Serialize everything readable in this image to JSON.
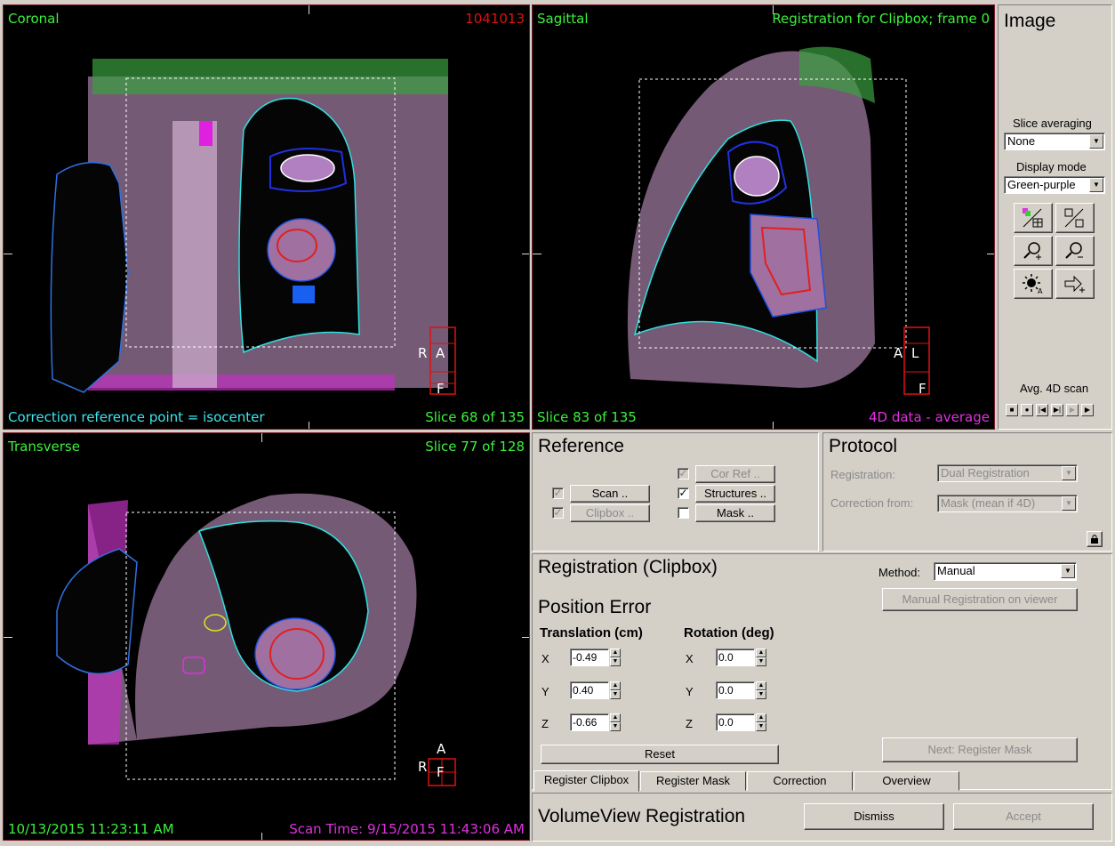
{
  "viewers": {
    "coronal": {
      "title": "Coronal",
      "id_number": "1041013",
      "footer_left": "Correction reference point = isocenter",
      "footer_right": "Slice 68 of 135",
      "orient_left": "R",
      "orient_top": "A",
      "orient_bottom": "F"
    },
    "sagittal": {
      "title": "Sagittal",
      "header_right": "Registration for Clipbox; frame 0",
      "footer_left": "Slice 83 of 135",
      "footer_right": "4D data - average",
      "orient_left": "A",
      "orient_top": "L",
      "orient_bottom": "F"
    },
    "transverse": {
      "title": "Transverse",
      "header_right": "Slice 77 of 128",
      "footer_left": "10/13/2015 11:23:11 AM",
      "footer_right": "Scan Time: 9/15/2015 11:43:06 AM",
      "orient_left": "R",
      "orient_top": "A",
      "orient_center": "F"
    }
  },
  "image_panel": {
    "title": "Image",
    "slice_averaging_label": "Slice averaging",
    "slice_averaging_value": "None",
    "display_mode_label": "Display mode",
    "display_mode_value": "Green-purple",
    "avg_4d_label": "Avg. 4D scan"
  },
  "reference": {
    "title": "Reference",
    "scan": {
      "label": "Scan ..",
      "checked": true,
      "enabled": false
    },
    "clipbox": {
      "label": "Clipbox ..",
      "checked": true,
      "enabled": false
    },
    "cor_ref": {
      "label": "Cor Ref ..",
      "checked": true,
      "enabled": false
    },
    "structures": {
      "label": "Structures ..",
      "checked": true,
      "enabled": true
    },
    "mask": {
      "label": "Mask ..",
      "checked": false,
      "enabled": true
    }
  },
  "protocol": {
    "title": "Protocol",
    "registration_label": "Registration:",
    "registration_value": "Dual Registration",
    "correction_from_label": "Correction from:",
    "correction_from_value": "Mask (mean if 4D)"
  },
  "registration": {
    "title": "Registration (Clipbox)",
    "method_label": "Method:",
    "method_value": "Manual",
    "manual_btn": "Manual Registration on viewer",
    "position_error_title": "Position Error",
    "translation_title": "Translation (cm)",
    "rotation_title": "Rotation (deg)",
    "axes": [
      "X",
      "Y",
      "Z"
    ],
    "translation_values": [
      "-0.49",
      "0.40",
      "-0.66"
    ],
    "rotation_values": [
      "0.0",
      "0.0",
      "0.0"
    ],
    "reset_btn": "Reset",
    "next_btn": "Next: Register Mask"
  },
  "tabs": [
    "Register Clipbox",
    "Register Mask",
    "Correction",
    "Overview"
  ],
  "footer": {
    "title": "VolumeView Registration",
    "dismiss": "Dismiss",
    "accept": "Accept"
  }
}
